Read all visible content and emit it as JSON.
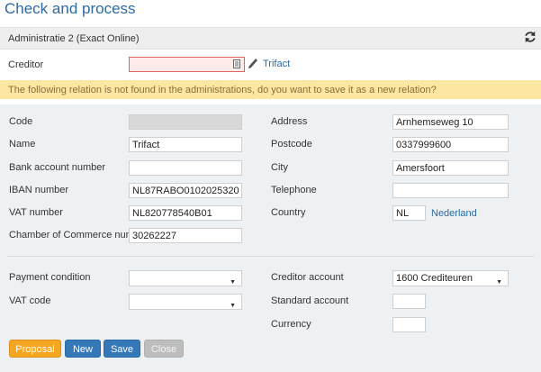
{
  "page": {
    "title": "Check and process"
  },
  "panel": {
    "label": "Administratie 2 (Exact Online)"
  },
  "creditor": {
    "label": "Creditor",
    "value": "",
    "link": "Trifact"
  },
  "warning": {
    "text": "The following relation is not found in the administrations, do you want to save it as a new relation?"
  },
  "left_fields": [
    {
      "label": "Code",
      "value": ""
    },
    {
      "label": "Name",
      "value": "Trifact"
    },
    {
      "label": "Bank account number",
      "value": ""
    },
    {
      "label": "IBAN number",
      "value": "NL87RABO0102025320"
    },
    {
      "label": "VAT number",
      "value": "NL820778540B01"
    },
    {
      "label": "Chamber of Commerce numb",
      "value": "30262227"
    }
  ],
  "right_fields": [
    {
      "label": "Address",
      "value": "Arnhemseweg 10"
    },
    {
      "label": "Postcode",
      "value": "0337999600"
    },
    {
      "label": "City",
      "value": "Amersfoort"
    },
    {
      "label": "Telephone",
      "value": ""
    },
    {
      "label": "Country",
      "value": "NL",
      "link": "Nederland"
    }
  ],
  "bottom_left": [
    {
      "label": "Payment condition",
      "value": ""
    },
    {
      "label": "VAT code",
      "value": ""
    }
  ],
  "bottom_right": [
    {
      "label": "Creditor account",
      "value": "1600 Crediteuren"
    },
    {
      "label": "Standard account",
      "value": ""
    },
    {
      "label": "Currency",
      "value": ""
    }
  ],
  "buttons": {
    "proposal": "Proposal",
    "new": "New",
    "save": "Save",
    "close": "Close"
  },
  "icons": {
    "refresh": "refresh-icon",
    "lookup": "lookup-icon",
    "edit": "pencil-icon",
    "dropdown": "caret-down-icon"
  },
  "colors": {
    "accent": "#2e6aa0",
    "warning_bg": "#fbe7a1",
    "proposal": "#f5a623",
    "primary": "#3578b8",
    "disabled": "#bdbdbd"
  }
}
